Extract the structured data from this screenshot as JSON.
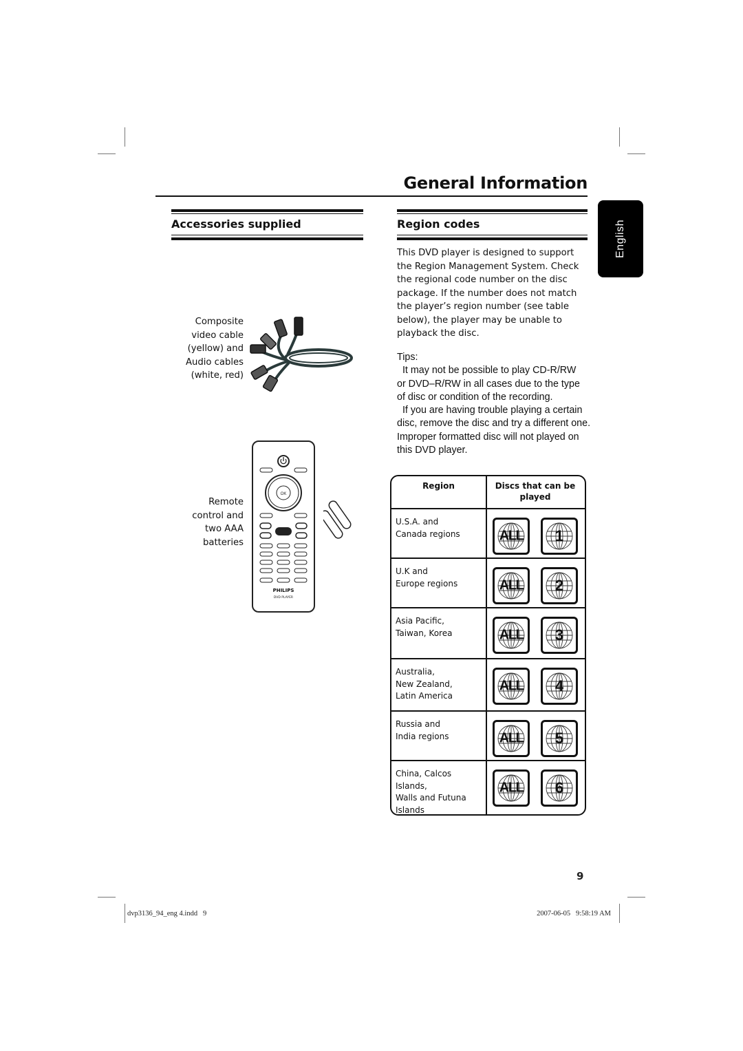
{
  "header": {
    "title": "General Information",
    "language_tab": "English"
  },
  "accessories": {
    "heading": "Accessories supplied",
    "cable_caption": [
      "Composite",
      "video cable",
      "(yellow) and",
      "Audio cables",
      "(white, red)"
    ],
    "remote_caption": [
      "Remote",
      "control and",
      "two AAA",
      "batteries"
    ],
    "remote_brand": "PHILIPS",
    "remote_model": "DVD PLAYER",
    "remote_center": "OK"
  },
  "region_codes": {
    "heading": "Region codes",
    "intro_lines": [
      "This DVD player is designed to support",
      "the Region Management System. Check",
      "the regional code number on the disc",
      "package. If the number does not match",
      "the player’s region number (see table",
      "below), the player may be unable to",
      "playback the disc."
    ],
    "tips_label": "Tips:",
    "tips_lines": [
      "  It may not be possible to play CD-R/RW",
      "or DVD–R/RW in all cases due to the type",
      "of disc or condition of the recording.",
      "  If you are having trouble playing a certain",
      "disc, remove the disc and try a different one.",
      "Improper formatted disc will not played on",
      "this DVD player."
    ],
    "table": {
      "headers": [
        "Region",
        "Discs that can be played"
      ],
      "rows": [
        {
          "region": [
            "U.S.A. and",
            "Canada regions"
          ],
          "codes": [
            "ALL",
            "1"
          ]
        },
        {
          "region": [
            "U.K and",
            "Europe regions"
          ],
          "codes": [
            "ALL",
            "2"
          ]
        },
        {
          "region": [
            "Asia Pacific,",
            "Taiwan, Korea"
          ],
          "codes": [
            "ALL",
            "3"
          ]
        },
        {
          "region": [
            "Australia,",
            "New Zealand,",
            "Latin America"
          ],
          "codes": [
            "ALL",
            "4"
          ]
        },
        {
          "region": [
            "Russia and",
            "India regions"
          ],
          "codes": [
            "ALL",
            "5"
          ]
        },
        {
          "region": [
            "China, Calcos Islands,",
            "Walls and Futuna",
            "Islands"
          ],
          "codes": [
            "ALL",
            "6"
          ]
        }
      ]
    }
  },
  "footer": {
    "page_number": "9",
    "file_name": "dvp3136_94_eng 4.indd   9",
    "timestamp": "2007-06-05   9:58:19 AM"
  }
}
